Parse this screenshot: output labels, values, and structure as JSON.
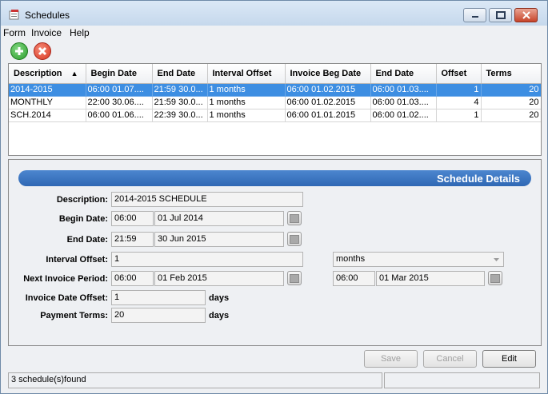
{
  "window": {
    "title": "Schedules"
  },
  "menu": [
    "Form",
    "Invoice",
    "Help"
  ],
  "toolbar": {
    "add_icon": "add-icon",
    "delete_icon": "delete-icon"
  },
  "grid": {
    "columns": [
      "Description",
      "Begin Date",
      "End Date",
      "Interval Offset",
      "Invoice Beg Date",
      "End Date",
      "Offset",
      "Terms"
    ],
    "sort_indicator": "▲",
    "rows": [
      [
        "2014-2015",
        "06:00 01.07....",
        "21:59 30.0...",
        "1 months",
        "06:00 01.02.2015",
        "06:00 01.03....",
        "1",
        "20"
      ],
      [
        "MONTHLY",
        "22:00 30.06....",
        "21:59 30.0...",
        "1 months",
        "06:00 01.02.2015",
        "06:00 01.03....",
        "4",
        "20"
      ],
      [
        "SCH.2014",
        "06:00 01.06....",
        "22:39 30.0...",
        "1 months",
        "06:00 01.01.2015",
        "06:00 01.02....",
        "1",
        "20"
      ]
    ],
    "selected_row": 0
  },
  "details": {
    "banner": "Schedule Details",
    "description_label": "Description:",
    "description": "2014-2015 SCHEDULE",
    "begin_label": "Begin Date:",
    "begin_time": "06:00",
    "begin_date": "01 Jul 2014",
    "end_label": "End Date:",
    "end_time": "21:59",
    "end_date": "30 Jun 2015",
    "interval_label": "Interval Offset:",
    "interval_value": "1",
    "interval_unit": "months",
    "next_label": "Next Invoice Period:",
    "next_start_time": "06:00",
    "next_start_date": "01 Feb 2015",
    "next_end_time": "06:00",
    "next_end_date": "01 Mar 2015",
    "invoice_offset_label": "Invoice Date Offset:",
    "invoice_offset": "1",
    "payment_label": "Payment Terms:",
    "payment_terms": "20",
    "days": "days"
  },
  "buttons": {
    "save": "Save",
    "cancel": "Cancel",
    "edit": "Edit"
  },
  "status": {
    "text": "3 schedule(s)found"
  },
  "colors": {
    "selection": "#3d8ee2",
    "banner": "#2f68b4",
    "add": "#2e9e2e",
    "delete": "#d9361f"
  }
}
